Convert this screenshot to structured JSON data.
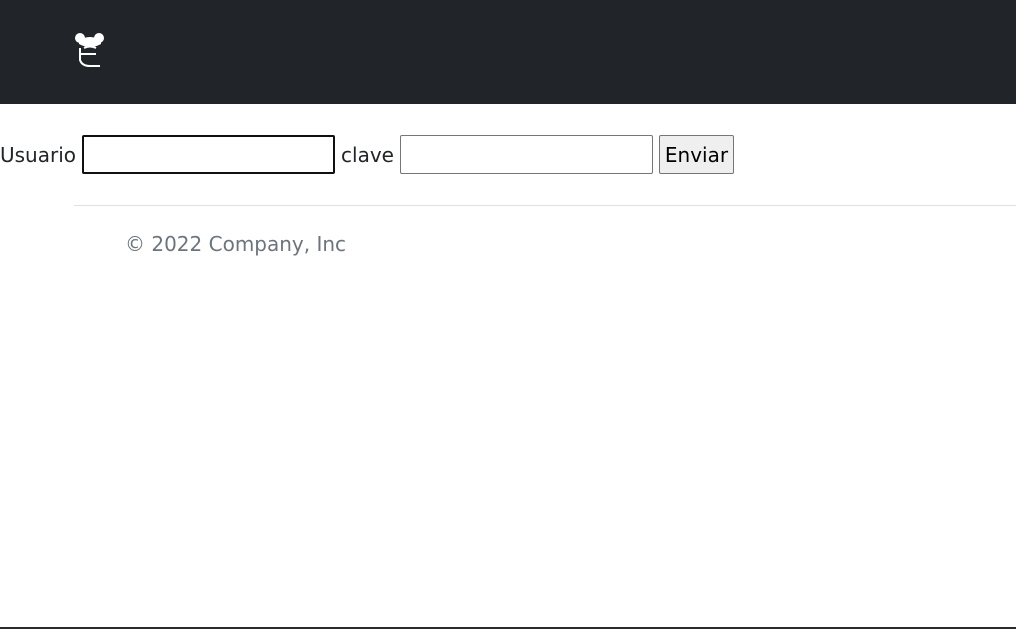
{
  "header": {
    "logo_icon": "mascot-logo-icon",
    "background_color": "#212529"
  },
  "login_form": {
    "username_label": "Usuario",
    "username_value": "",
    "password_label": "clave",
    "password_value": "",
    "submit_label": "Enviar"
  },
  "footer": {
    "copyright": "© 2022 Company, Inc",
    "text_color": "#6c757d"
  }
}
